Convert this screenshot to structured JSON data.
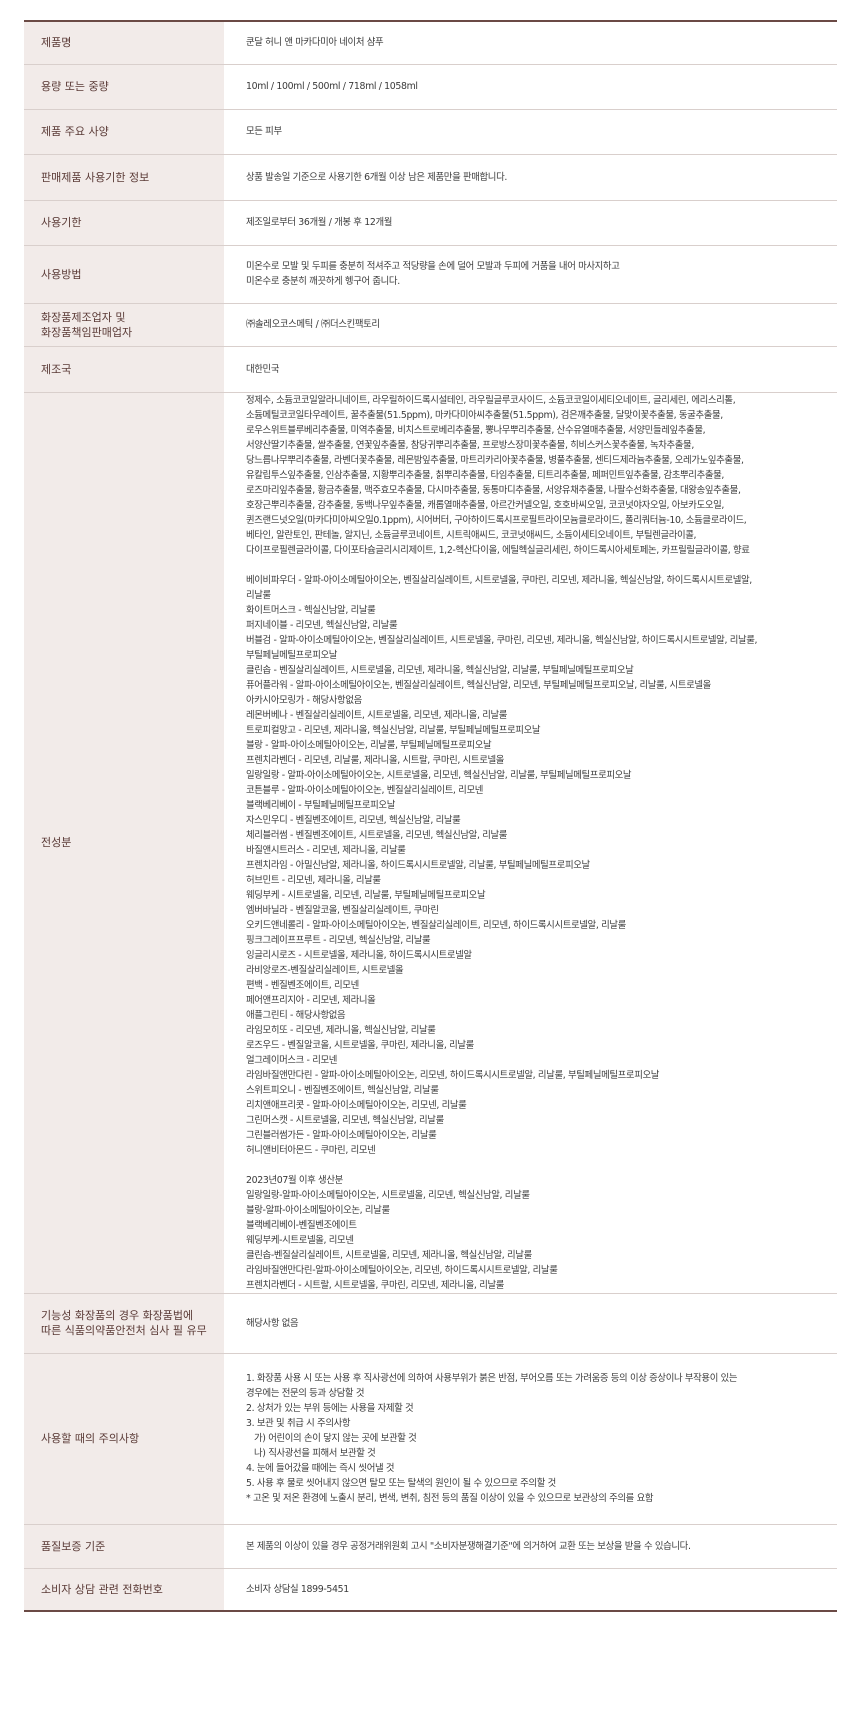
{
  "rows": [
    {
      "label": "제품명",
      "value": [
        "쿤달 허니 앤 마카다미아 네이처 샴푸"
      ]
    },
    {
      "label": "용량 또는 중량",
      "value": [
        "10ml / 100ml / 500ml / 718ml / 1058ml"
      ]
    },
    {
      "label": "제품 주요 사양",
      "value": [
        "모든 피부"
      ]
    },
    {
      "label": "판매제품 사용기한 정보",
      "value": [
        "상품 발송일 기준으로 사용기한 6개월 이상 남은 제품만을 판매합니다."
      ]
    },
    {
      "label": "사용기한",
      "value": [
        "제조일로부터 36개월 / 개봉 후 12개월"
      ]
    },
    {
      "label": "사용방법",
      "value": [
        "미온수로 모발 및 두피를 충분히 적셔주고 적당량을 손에 덜어 모발과 두피에 거품을 내어 마사지하고",
        "미온수로 충분히 깨끗하게 헹구어 줍니다."
      ]
    },
    {
      "label": "화장품제조업자 및\n화장품책임판매업자",
      "value": [
        "㈜솔레오코스메틱 / ㈜더스킨팩토리"
      ]
    },
    {
      "label": "제조국",
      "value": [
        "대한민국"
      ]
    },
    {
      "label": "전성분",
      "value": [
        "정제수, 소듐코코일알라니네이트, 라우릴하이드록시설테인, 라우릴글루코사이드, 소듐코코일이세티오네이트, 글리세린, 에리스리톨,",
        "소듐메틸코코일타우레이트, 꿀추출물(51.5ppm), 마카다미아씨추출물(51.5ppm), 검은깨추출물, 달맞이꽃추출물, 동굴추출물,",
        "로우스위트블루베리추출물, 미역추출물, 비치스트로베리추출물, 뽕나무뿌리추출물, 산수유열매추출물, 서양민들레잎추출물,",
        "서양산딸기추출물, 쌀추출물, 연꽃잎추출물, 참당귀뿌리추출물, 프로방스장미꽃추출물, 히비스커스꽃추출물, 녹차추출물,",
        "당느릅나무뿌리추출물, 라벤더꽃추출물, 레몬밤잎추출물, 마트리카리아꽃추출물, 병풀추출물, 센티드제라늄추출물, 오레가노잎추출물,",
        "유칼립투스잎추출물, 인삼추출물, 지황뿌리추출물, 칡뿌리추출물, 타임추출물, 티트리추출물, 페퍼민트잎추출물, 감초뿌리추출물,",
        "로즈마리잎추출물, 황금추출물, 맥주효모추출물, 다시마추출물, 동통마디추출물, 서양유채추출물, 나팔수선화추출물, 대왕송잎추출물,",
        "호장근뿌리추출물, 감추출물, 동백나무잎추출물, 캐롭열매추출물, 아르간커넬오일, 호호바씨오일, 코코넛야자오일, 아보카도오일,",
        "퀸즈랜드넛오일(마카다미아씨오일0.1ppm), 시어버터, 구아하이드록시프로필트라이모늄클로라이드, 폴리쿼터늄-10, 소듐클로라이드,",
        "베타인, 알란토인, 판테놀, 알지닌, 소듐글루코네이트, 시트릭애씨드, 코코넛애씨드, 소듐이세티오네이트, 부틸렌글라이콜,",
        "다이프로필렌글라이콜, 다이포타슘글리시리제이트, 1,2-헥산다이올, 에틸헥실글리세린, 하이드록시아세토페논, 카프릴릴글라이콜, 향료",
        "",
        "베이비파우더 - 알파-아이소메틸아이오논, 벤질살리실레이트, 시트로넬올, 쿠마린, 리모넨, 제라니올, 헥실신남알, 하이드록시시트로넬알,",
        "리날룰",
        "화이트머스크 - 헥실신남알, 리날룰",
        "퍼지네이블 - 리모넨, 헥실신남알, 리날룰",
        "버블검 - 알파-아이소메틸아이오논, 벤질살리실레이트, 시트로넬올, 쿠마린, 리모넨, 제라니올, 헥실신남알, 하이드록시시트로넬알, 리날룰,",
        "부틸페닐메틸프로피오날",
        "클린솝 - 벤질살리실레이트, 시트로넬올, 리모넨, 제라니올, 헥실신남알, 리날룰, 부틸페닐메틸프로피오날",
        "퓨어플라워 - 알파-아이소메틸아이오논, 벤질살리실레이트, 헥실신남알, 리모넨, 부틸페닐메틸프로피오날, 리날룰, 시트로넬올",
        "아카시아모링가 - 해당사항없음",
        "레몬버베나 - 벤질살리실레이트, 시트로넬올, 리모넨, 제라니올, 리날룰",
        "트로피컬망고 - 리모넨, 제라니올, 헥실신남알, 리날룰, 부틸페닐메틸프로피오날",
        "블랑 - 알파-아이소메틸아이오논, 리날룰, 부틸페닐메틸프로피오날",
        "프렌치라벤더 - 리모넨, 리날룰, 제라니올, 시트랄, 쿠마린, 시트로넬올",
        "일랑일랑 - 알파-아이소메틸아이오논, 시트로넬올, 리모넨, 헥실신남알, 리날룰, 부틸페닐메틸프로피오날",
        "코튼블루 - 알파-아이소메틸아이오논, 벤질살리실레이트, 리모넨",
        "블랙베리베이 - 부틸페닐메틸프로피오날",
        "자스민우디 - 벤질벤조에이트, 리모넨, 헥실신남알, 리날룰",
        "체리블러썸 - 벤질벤조에이트, 시트로넬올, 리모넨, 헥실신남알, 리날룰",
        "바질앤시트러스 - 리모넨, 제라니올, 리날룰",
        "프렌치라임 - 아밀신남알, 제라니올, 하이드록시시트로넬알, 리날룰, 부틸페닐메틸프로피오날",
        "허브민트 - 리모넨, 제라니올, 리날룰",
        "웨딩부케 - 시트로넬올, 리모넨, 리날룰, 부틸페닐메틸프로피오날",
        "엠버바닐라 - 벤질알코올, 벤질살리실레이트, 쿠마린",
        "오키드앤네롤리 - 알파-아이소메틸아이오논, 벤질살리실레이트, 리모넨, 하이드록시시트로넬알, 리날룰",
        "핑크그레이프프루트 - 리모넨, 헥실신남알, 리날룰",
        "잉글리시로즈 - 시트로넬올, 제라니올, 하이드록시시트로넬알",
        "라비앙로즈-벤질살리실레이트, 시트로넬올",
        "편백 - 벤질벤조에이트, 리모넨",
        "페어앤프리지아 - 리모넨, 제라니올",
        "애플그린티 - 해당사항없음",
        "라임모히또 - 리모넨, 제라니올, 헥실신남알, 리날룰",
        "로즈우드 - 벤질알코올, 시트로넬올, 쿠마린, 제라니올, 리날룰",
        "얼그레이머스크 - 리모넨",
        "라임바질앤만다린 - 알파-아이소메틸아이오논, 리모넨, 하이드록시시트로넬알, 리날룰, 부틸페닐메틸프로피오날",
        "스위트피오니 - 벤질벤조에이트, 헥실신남알, 리날룰",
        "리치앤애프리콧 - 알파-아이소메틸아이오논, 리모넨, 리날룰",
        "그린머스캣 - 시트로넬올, 리모넨, 헥실신남알, 리날룰",
        "그린블러썸가든 - 알파-아이소메틸아이오논, 리날룰",
        "허니앤비터아몬드 - 쿠마린, 리모넨",
        "",
        "2023년07월 이후 생산분",
        "일랑일랑-알파-아이소메틸아이오논, 시트로넬올, 리모넨, 헥실신남알, 리날룰",
        "블랑-알파-아이소메틸아이오논, 리날룰",
        "블랙베리베이-벤질벤조에이트",
        "웨딩부케-시트로넬올, 리모넨",
        "클린솝-벤질살리실레이트, 시트로넬올, 리모넨, 제라니올, 헥실신남알, 리날룰",
        "라임바질앤만다린-알파-아이소메틸아이오논, 리모넨, 하이드록시시트로넬알, 리날룰",
        "프렌치라벤더 - 시트랄, 시트로넬올, 쿠마린, 리모넨, 제라니올, 리날룰"
      ]
    },
    {
      "label": "기능성 화장품의 경우 화장품법에\n따른 식품의약품안전처 심사 필 유무",
      "value": [
        "해당사항 없음"
      ]
    },
    {
      "label": "사용할 때의 주의사항",
      "value": [
        "1. 화장품 사용 시 또는 사용 후 직사광선에 의하여 사용부위가 붉은 반점, 부어오름 또는 가려움증 등의 이상 증상이나 부작용이 있는",
        "경우에는 전문의 등과 상담할 것",
        "2. 상처가 있는 부위 등에는 사용을 자제할 것",
        "3. 보관 및 취급 시 주의사항",
        "  가) 어린이의 손이 닿지 않는 곳에 보관할 것",
        "  나) 직사광선을 피해서 보관할 것",
        "4. 눈에 들어갔을 때에는 즉시 씻어낼 것",
        "5. 사용 후 물로 씻어내지 않으면 탈모 또는 탈색의 원인이 될 수 있으므로 주의할 것",
        "* 고온 및 저온 환경에 노출시 분리, 변색, 변취, 침전 등의 품질 이상이 있을 수 있으므로 보관상의 주의를 요함"
      ]
    },
    {
      "label": "품질보증 기준",
      "value": [
        "본 제품의 이상이 있을 경우 공정거래위원회 고시 \"소비자분쟁해결기준\"에 의거하여 교환 또는 보상을 받을 수 있습니다."
      ]
    },
    {
      "label": "소비자 상담 관련 전화번호",
      "value": [
        "소비자 상담실 1899-5451"
      ]
    }
  ],
  "colors": {
    "border_accent": "#6b4a45",
    "label_bg": "#f2ebe9",
    "label_text": "#5a3a36",
    "divider": "#d9cfcc"
  }
}
